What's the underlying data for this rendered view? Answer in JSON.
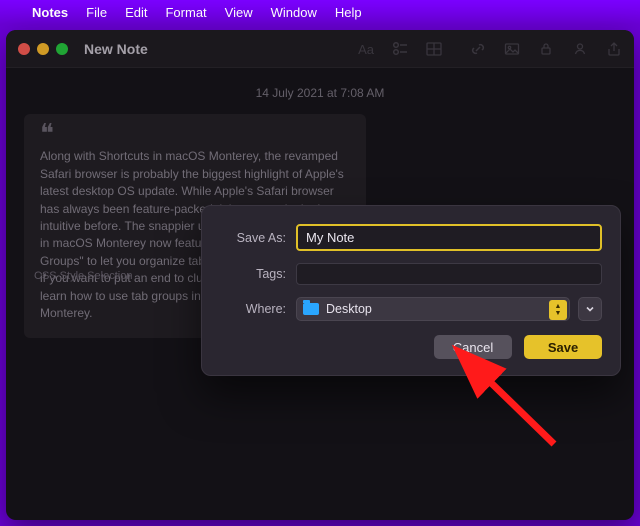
{
  "menubar": {
    "app": "Notes",
    "items": [
      "File",
      "Edit",
      "Format",
      "View",
      "Window",
      "Help"
    ]
  },
  "window": {
    "title": "New Note",
    "timestamp": "14 July 2021 at 7:08 AM",
    "quote": "Along with Shortcuts in macOS Monterey, the revamped Safari browser is probably the biggest highlight of Apple's latest desktop OS update. While Apple's Safari browser has always been feature-packed, it has never looked so intuitive before. The snappier user interface aside, Safari in macOS Monterey now features the long-awaited \"Tab Groups\" to let you organize tabs to your heart's liking. So, if you want to put an end to cluttered tab management, learn how to use tab groups in Safari on macOS Monterey.",
    "tab_caption": "CSS Style Selection"
  },
  "dialog": {
    "saveas_label": "Save As:",
    "saveas_value": "My Note",
    "tags_label": "Tags:",
    "tags_value": "",
    "where_label": "Where:",
    "where_value": "Desktop",
    "cancel": "Cancel",
    "save": "Save"
  },
  "icons": {
    "apple": "apple-logo-icon",
    "text_style": "text-style-icon",
    "checklist": "checklist-icon",
    "table": "table-icon",
    "link": "link-icon",
    "photo": "photo-icon",
    "lock": "lock-icon",
    "collab": "collaborate-icon",
    "share": "share-icon",
    "folder": "folder-icon",
    "chevron": "chevron-down-icon",
    "updown": "up-down-icon"
  }
}
